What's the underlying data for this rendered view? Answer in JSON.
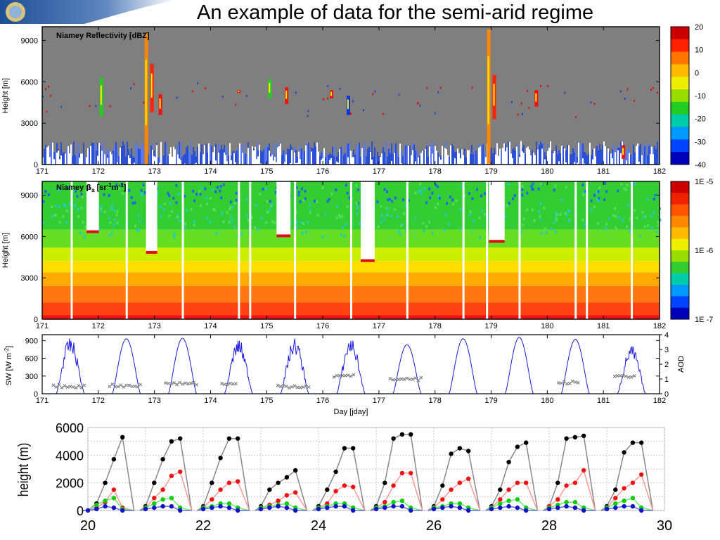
{
  "slide": {
    "title": "An example of data for the semi-arid regime"
  },
  "chart_data": [
    {
      "type": "heatmap",
      "title": "Niamey Reflectivity [dBZ]",
      "ylabel": "Height [m]",
      "xlim": [
        171,
        182
      ],
      "ylim": [
        0,
        10000
      ],
      "x_ticks": [
        171,
        172,
        173,
        174,
        175,
        176,
        177,
        178,
        179,
        180,
        181,
        182
      ],
      "y_ticks": [
        0,
        3000,
        6000,
        9000
      ],
      "colorbar": {
        "min": -40,
        "max": 20,
        "ticks": [
          20,
          10,
          0,
          -10,
          -20,
          -30,
          -40
        ]
      },
      "background_color": "#7f7f7f",
      "low_layer_top_m": 1700,
      "echo_events": [
        {
          "day": 172.05,
          "top": 6300,
          "bottom": 3500,
          "color": "#22cc22"
        },
        {
          "day": 172.85,
          "top": 9500,
          "bottom": 0,
          "color": "#ff8800"
        },
        {
          "day": 172.95,
          "top": 7300,
          "bottom": 3800,
          "color": "#ff2200"
        },
        {
          "day": 173.1,
          "top": 5100,
          "bottom": 3600,
          "color": "#ee1111"
        },
        {
          "day": 174.5,
          "top": 5400,
          "bottom": 5200,
          "color": "#ee1111"
        },
        {
          "day": 175.05,
          "top": 6200,
          "bottom": 4800,
          "color": "#22cc22"
        },
        {
          "day": 175.35,
          "top": 5600,
          "bottom": 4400,
          "color": "#ee1111"
        },
        {
          "day": 176.15,
          "top": 5400,
          "bottom": 4800,
          "color": "#ee1111"
        },
        {
          "day": 176.45,
          "top": 5000,
          "bottom": 3600,
          "color": "#1133dd"
        },
        {
          "day": 178.95,
          "top": 9800,
          "bottom": 0,
          "color": "#ff8800"
        },
        {
          "day": 179.05,
          "top": 6500,
          "bottom": 3300,
          "color": "#ff2200"
        },
        {
          "day": 179.8,
          "top": 5400,
          "bottom": 4200,
          "color": "#ee1111"
        },
        {
          "day": 181.35,
          "top": 1400,
          "bottom": 400,
          "color": "#ee1111"
        }
      ]
    },
    {
      "type": "heatmap",
      "title": "Niamey β_a [sr⁻¹m⁻¹]",
      "title_parts": [
        "Niamey ",
        "β",
        "a",
        " [sr",
        "-1",
        "m",
        "-1",
        "]"
      ],
      "ylabel": "Height [m]",
      "xlim": [
        171,
        182
      ],
      "ylim": [
        0,
        10000
      ],
      "x_ticks": [
        171,
        172,
        173,
        174,
        175,
        176,
        177,
        178,
        179,
        180,
        181,
        182
      ],
      "y_ticks": [
        0,
        3000,
        6000,
        9000
      ],
      "colorbar": {
        "scale": "log",
        "ticks": [
          "1E -5",
          "1E -6",
          "1E -7"
        ]
      },
      "gap_days": [
        171.52,
        172.5,
        173.5,
        174.5,
        174.7,
        175.5,
        176.5,
        177.5,
        178.5,
        178.92,
        179.5,
        180.5,
        180.7,
        181.5
      ],
      "cloud_gaps": [
        {
          "day": 171.9,
          "width": 0.22,
          "top": 10000,
          "bottom": 6300
        },
        {
          "day": 172.95,
          "width": 0.2,
          "top": 10000,
          "bottom": 4800
        },
        {
          "day": 175.3,
          "width": 0.25,
          "top": 10000,
          "bottom": 6000
        },
        {
          "day": 176.8,
          "width": 0.25,
          "top": 10000,
          "bottom": 4200
        },
        {
          "day": 179.1,
          "width": 0.28,
          "top": 10000,
          "bottom": 5600
        }
      ]
    },
    {
      "type": "line",
      "xlabel": "Day [jday]",
      "ylabel": "SW [W m⁻²]",
      "ylabel_parts": [
        "SW [W m",
        "-2",
        "]"
      ],
      "y2label": "AOD",
      "xlim": [
        171,
        182
      ],
      "ylim": [
        0,
        1000
      ],
      "y2lim": [
        0,
        4
      ],
      "x_ticks": [
        171,
        172,
        173,
        174,
        175,
        176,
        177,
        178,
        179,
        180,
        181,
        182
      ],
      "y_ticks": [
        0,
        300,
        600,
        900
      ],
      "y2_ticks": [
        0,
        1,
        2,
        3,
        4
      ],
      "series": [
        {
          "name": "SW",
          "color": "#1a1adc",
          "days": [
            171,
            172,
            173,
            174,
            175,
            176,
            177,
            178,
            179,
            180,
            181
          ],
          "peaks": [
            960,
            930,
            940,
            930,
            950,
            960,
            830,
            930,
            955,
            920,
            820
          ]
        },
        {
          "name": "AOD",
          "color": "#808080",
          "marker": "x",
          "segments": [
            {
              "from": 171.2,
              "to": 171.8,
              "value": 0.5
            },
            {
              "from": 172.2,
              "to": 172.8,
              "value": 0.55
            },
            {
              "from": 173.2,
              "to": 173.8,
              "value": 0.7
            },
            {
              "from": 174.2,
              "to": 174.5,
              "value": 0.65
            },
            {
              "from": 175.2,
              "to": 175.8,
              "value": 0.5
            },
            {
              "from": 176.2,
              "to": 176.6,
              "value": 1.2
            },
            {
              "from": 177.2,
              "to": 177.8,
              "value": 1.0
            },
            {
              "from": 180.2,
              "to": 180.6,
              "value": 0.75
            },
            {
              "from": 181.2,
              "to": 181.6,
              "value": 1.2
            }
          ]
        }
      ]
    },
    {
      "type": "line",
      "ylabel": "height (m)",
      "xlim": [
        20,
        30
      ],
      "ylim": [
        0,
        6000
      ],
      "x_ticks": [
        20,
        22,
        24,
        26,
        28,
        30
      ],
      "y_ticks": [
        0,
        2000,
        4000,
        6000
      ],
      "days": [
        20,
        21,
        22,
        23,
        24,
        25,
        26,
        27,
        28,
        29
      ],
      "series": [
        {
          "name": "black",
          "color": "#000000",
          "line_color": "#888888",
          "values": [
            [
              0,
              500,
              2000,
              3700,
              5300
            ],
            [
              300,
              2000,
              3700,
              5000,
              5200
            ],
            [
              300,
              2000,
              3800,
              5200,
              5200
            ],
            [
              300,
              1500,
              2000,
              2400,
              2900
            ],
            [
              300,
              1500,
              2800,
              4500,
              4500
            ],
            [
              300,
              2000,
              5200,
              5500,
              5500
            ],
            [
              300,
              1800,
              4100,
              4500,
              4300
            ],
            [
              300,
              1500,
              3500,
              4600,
              4900
            ],
            [
              300,
              2000,
              5200,
              5300,
              5400
            ],
            [
              300,
              1500,
              4200,
              4900,
              4900
            ]
          ]
        },
        {
          "name": "red",
          "color": "#ee1111",
          "line_color": "#ff9999",
          "values": [
            [
              0,
              200,
              600,
              1500,
              200
            ],
            [
              200,
              900,
              1500,
              2500,
              2800
            ],
            [
              200,
              800,
              1500,
              2000,
              2100
            ],
            [
              200,
              400,
              700,
              1100,
              1300
            ],
            [
              200,
              500,
              1400,
              1800,
              1700
            ],
            [
              200,
              600,
              1800,
              2700,
              2700
            ],
            [
              200,
              800,
              1500,
              2000,
              2300
            ],
            [
              200,
              800,
              1500,
              2000,
              2000
            ],
            [
              300,
              800,
              1800,
              2000,
              2900
            ],
            [
              200,
              900,
              1600,
              2000,
              2600
            ]
          ]
        },
        {
          "name": "green",
          "color": "#11cc11",
          "line_color": "#66ee66",
          "values": [
            [
              0,
              400,
              700,
              900,
              100
            ],
            [
              200,
              500,
              800,
              900,
              200
            ],
            [
              200,
              300,
              500,
              500,
              200
            ],
            [
              200,
              300,
              400,
              500,
              200
            ],
            [
              200,
              300,
              500,
              500,
              200
            ],
            [
              200,
              300,
              600,
              700,
              200
            ],
            [
              200,
              300,
              500,
              500,
              200
            ],
            [
              200,
              500,
              700,
              800,
              200
            ],
            [
              200,
              400,
              600,
              600,
              200
            ],
            [
              200,
              500,
              700,
              900,
              200
            ]
          ]
        },
        {
          "name": "blue",
          "color": "#1111cc",
          "line_color": "#6666ee",
          "values": [
            [
              0,
              100,
              300,
              200,
              0
            ],
            [
              100,
              200,
              300,
              300,
              0
            ],
            [
              100,
              200,
              300,
              200,
              0
            ],
            [
              100,
              200,
              300,
              200,
              0
            ],
            [
              100,
              200,
              300,
              300,
              0
            ],
            [
              100,
              200,
              300,
              300,
              0
            ],
            [
              100,
              200,
              300,
              200,
              0
            ],
            [
              100,
              200,
              300,
              200,
              0
            ],
            [
              100,
              200,
              300,
              200,
              0
            ],
            [
              100,
              200,
              300,
              300,
              0
            ]
          ]
        }
      ]
    }
  ]
}
